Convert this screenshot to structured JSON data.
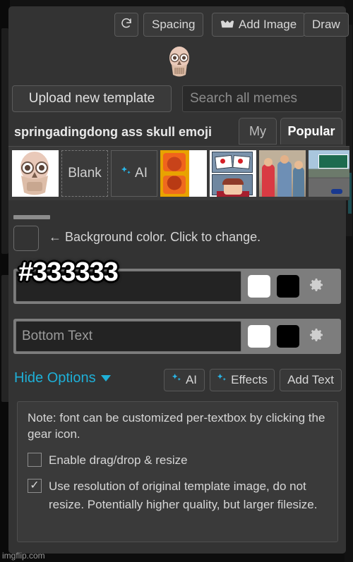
{
  "app": {
    "watermark": "imgflip.com"
  },
  "toolbar": {
    "refresh_icon": "refresh-icon",
    "spacing_label": "Spacing",
    "add_image_label": "Add Image",
    "add_image_icon": "image-icon",
    "draw_label": "Draw"
  },
  "preview": {
    "image_alt": "skull-emoji-template"
  },
  "template_search": {
    "upload_label": "Upload new template",
    "search_placeholder": "Search all memes",
    "search_value": ""
  },
  "template_header": {
    "title": "springadingdong ass skull emoji",
    "tabs": [
      {
        "label": "My",
        "active": false
      },
      {
        "label": "Popular",
        "active": true
      }
    ]
  },
  "thumbnails": [
    {
      "name": "skull-emoji-thumb",
      "kind": "image",
      "art": "t-skull",
      "label": ""
    },
    {
      "name": "blank-thumb",
      "kind": "dashed",
      "art": "",
      "label": "Blank"
    },
    {
      "name": "ai-thumb",
      "kind": "solid",
      "art": "",
      "label": "AI"
    },
    {
      "name": "orange-template-thumb",
      "kind": "image",
      "art": "t-orange",
      "label": ""
    },
    {
      "name": "rorschach-template-thumb",
      "kind": "image",
      "art": "t-rorschach",
      "label": ""
    },
    {
      "name": "distracted-boyfriend-thumb",
      "kind": "image",
      "art": "t-boyfriend",
      "label": ""
    },
    {
      "name": "left-exit-12-thumb",
      "kind": "image",
      "art": "t-exit",
      "label": ""
    }
  ],
  "background_color": {
    "label": "← Background color. Click to change.",
    "swatch_hex": "#333333"
  },
  "textboxes": [
    {
      "name": "top-text",
      "value": "",
      "placeholder": "",
      "overlay_text": "#333333",
      "color_primary": "#ffffff",
      "color_secondary": "#000000",
      "gear_icon": "gear-icon"
    },
    {
      "name": "bottom-text",
      "value": "",
      "placeholder": "Bottom Text",
      "overlay_text": "",
      "color_primary": "#ffffff",
      "color_secondary": "#000000",
      "gear_icon": "gear-icon"
    }
  ],
  "options_bar": {
    "hide_options_label": "Hide Options",
    "caret_icon": "chevron-down-icon",
    "ai_label": "AI",
    "effects_label": "Effects",
    "add_text_label": "Add Text",
    "link_color": "#1eb0d8"
  },
  "note_panel": {
    "note": "Note: font can be customized per-textbox by clicking the gear icon.",
    "checkboxes": [
      {
        "label": "Enable drag/drop & resize",
        "checked": false,
        "mark": ""
      },
      {
        "label": "Use resolution of original template image, do not resize. Potentially higher quality, but larger filesize.",
        "checked": true,
        "mark": "✓"
      }
    ]
  }
}
